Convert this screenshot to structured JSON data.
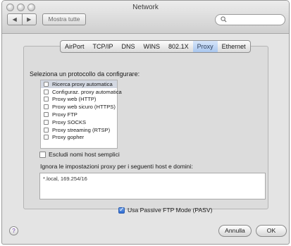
{
  "window": {
    "title": "Network"
  },
  "toolbar": {
    "back_glyph": "◀",
    "forward_glyph": "▶",
    "show_all_label": "Mostra tutte",
    "search_placeholder": ""
  },
  "tabs": [
    {
      "label": "AirPort",
      "active": false
    },
    {
      "label": "TCP/IP",
      "active": false
    },
    {
      "label": "DNS",
      "active": false
    },
    {
      "label": "WINS",
      "active": false
    },
    {
      "label": "802.1X",
      "active": false
    },
    {
      "label": "Proxy",
      "active": true
    },
    {
      "label": "Ethernet",
      "active": false
    }
  ],
  "proxy": {
    "select_label": "Seleziona un protocollo da configurare:",
    "protocols": [
      {
        "label": "Ricerca proxy automatica",
        "checked": false,
        "selected": true
      },
      {
        "label": "Configuraz. proxy automatica",
        "checked": false,
        "selected": false
      },
      {
        "label": "Proxy web (HTTP)",
        "checked": false,
        "selected": false
      },
      {
        "label": "Proxy web sicuro (HTTPS)",
        "checked": false,
        "selected": false
      },
      {
        "label": "Proxy FTP",
        "checked": false,
        "selected": false
      },
      {
        "label": "Proxy SOCKS",
        "checked": false,
        "selected": false
      },
      {
        "label": "Proxy streaming (RTSP)",
        "checked": false,
        "selected": false
      },
      {
        "label": "Proxy gopher",
        "checked": false,
        "selected": false
      }
    ],
    "exclude_simple_label": "Escludi nomi host semplici",
    "exclude_simple_checked": false,
    "bypass_label": "Ignora le impostazioni proxy per i seguenti host e domini:",
    "bypass_value": "*.local, 169.254/16",
    "pasv_label": "Usa Passive FTP Mode (PASV)",
    "pasv_checked": true
  },
  "footer": {
    "help_glyph": "?",
    "cancel_label": "Annulla",
    "ok_label": "OK"
  },
  "colors": {
    "accent": "#a9c6ee",
    "checkbox": "#2f6bd2"
  }
}
